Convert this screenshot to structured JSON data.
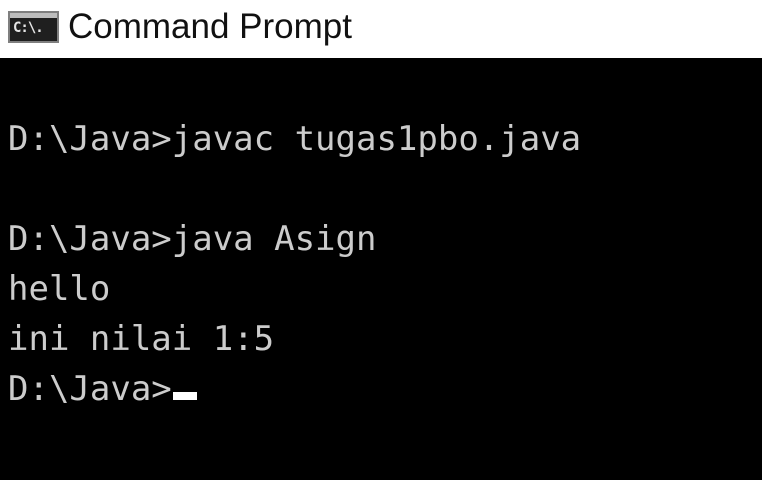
{
  "window": {
    "title": "Command Prompt",
    "icon": "cmd-app-icon",
    "icon_glyph": "C:\\."
  },
  "console": {
    "background": "#000000",
    "text_color": "#cccccc",
    "lines": [
      "",
      "D:\\Java>javac tugas1pbo.java",
      "",
      "D:\\Java>java Asign",
      "hello",
      "ini nilai 1:5",
      "D:\\Java>"
    ]
  }
}
